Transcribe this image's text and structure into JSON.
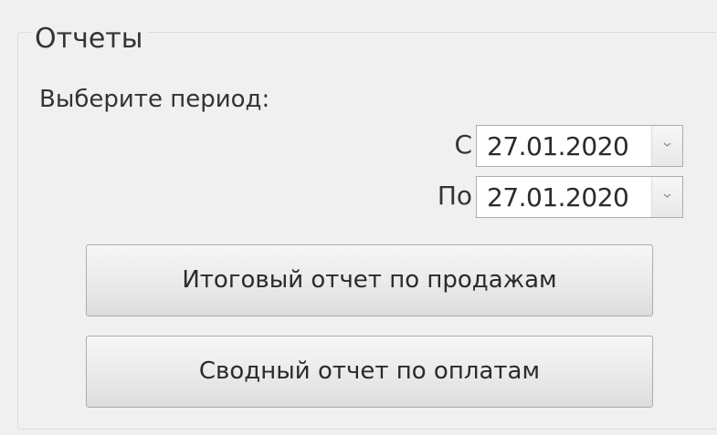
{
  "group": {
    "title": "Отчеты",
    "period_label": "Выберите период:"
  },
  "date_from": {
    "label": "С",
    "value": "27.01.2020",
    "dropdown_icon": "chevron-down-icon"
  },
  "date_to": {
    "label": "По",
    "value": "27.01.2020",
    "dropdown_icon": "chevron-down-icon"
  },
  "buttons": {
    "sales_report": "Итоговый отчет по продажам",
    "payments_report": "Сводный отчет по оплатам"
  },
  "colors": {
    "background": "#f0f0f0",
    "border": "#d5dfe5",
    "text": "#2b2b2b"
  }
}
